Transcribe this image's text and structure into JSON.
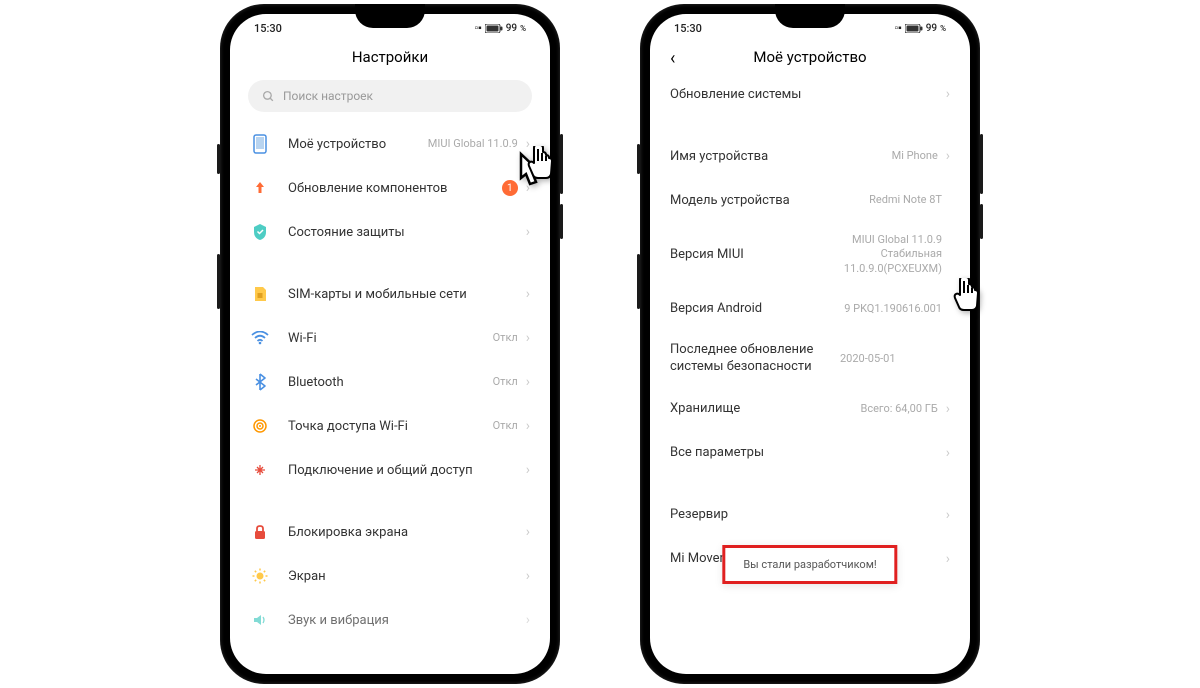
{
  "status": {
    "time": "15:30",
    "battery": "99"
  },
  "phone1": {
    "title": "Настройки",
    "search_placeholder": "Поиск настроек",
    "items": [
      {
        "label": "Моё устройство",
        "value": "MIUI Global 11.0.9"
      },
      {
        "label": "Обновление компонентов",
        "badge": "1"
      },
      {
        "label": "Состояние защиты"
      }
    ],
    "group2": [
      {
        "label": "SIM-карты и мобильные сети"
      },
      {
        "label": "Wi-Fi",
        "value": "Откл"
      },
      {
        "label": "Bluetooth",
        "value": "Откл"
      },
      {
        "label": "Точка доступа Wi-Fi",
        "value": "Откл"
      },
      {
        "label": "Подключение и общий доступ"
      }
    ],
    "group3": [
      {
        "label": "Блокировка экрана"
      },
      {
        "label": "Экран"
      },
      {
        "label": "Звук и вибрация"
      }
    ]
  },
  "phone2": {
    "title": "Моё устройство",
    "items": [
      {
        "label": "Обновление системы"
      }
    ],
    "group2": [
      {
        "label": "Имя устройства",
        "value": "Mi Phone"
      },
      {
        "label": "Модель устройства",
        "value": "Redmi Note 8T"
      },
      {
        "label": "Версия MIUI",
        "value": "MIUI Global 11.0.9\nСтабильная\n11.0.9.0(PCXEUXM)"
      },
      {
        "label": "Версия Android",
        "value": "9 PKQ1.190616.001"
      },
      {
        "label": "Последнее обновление системы безопасности",
        "value": "2020-05-01"
      },
      {
        "label": "Хранилище",
        "value": "Всего: 64,00 ГБ"
      },
      {
        "label": "Все параметры"
      }
    ],
    "group3": [
      {
        "label": "Резервир"
      },
      {
        "label": "Mi Mover"
      }
    ],
    "toast": "Вы стали разработчиком!"
  }
}
